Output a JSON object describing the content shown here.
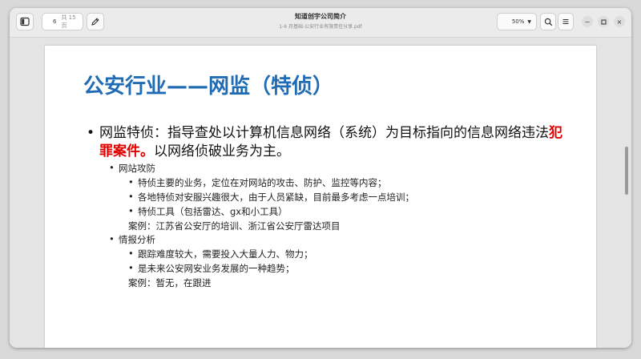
{
  "header": {
    "current_page": "6",
    "total_pages": "共 15 页",
    "title": "知道创宇公司简介",
    "subtitle": "1-6 月基础-公安行业有限责任分享.pdf",
    "zoom": "50%"
  },
  "slide": {
    "title": "公安行业——网监（特侦）",
    "main_bullet_prefix": "网监特侦：指导查处以计算机信息网络（系统）为目标指向的信息网络违法",
    "main_bullet_highlight": "犯罪案件。",
    "main_bullet_suffix": "以网络侦破业务为主。",
    "sections": [
      {
        "heading": "网站攻防",
        "items": [
          "特侦主要的业务，定位在对网站的攻击、防护、监控等内容；",
          "各地特侦对安服兴趣很大，由于人员紧缺，目前最多考虑一点培训；",
          "特侦工具（包括雷达、gx和小工具）"
        ],
        "case": "案例：江苏省公安厅的培训、浙江省公安厅雷达项目"
      },
      {
        "heading": "情报分析",
        "items": [
          "跟踪难度较大，需要投入大量人力、物力；",
          "是未来公安网安业务发展的一种趋势；"
        ],
        "case": "案例：暂无，在跟进"
      }
    ]
  }
}
